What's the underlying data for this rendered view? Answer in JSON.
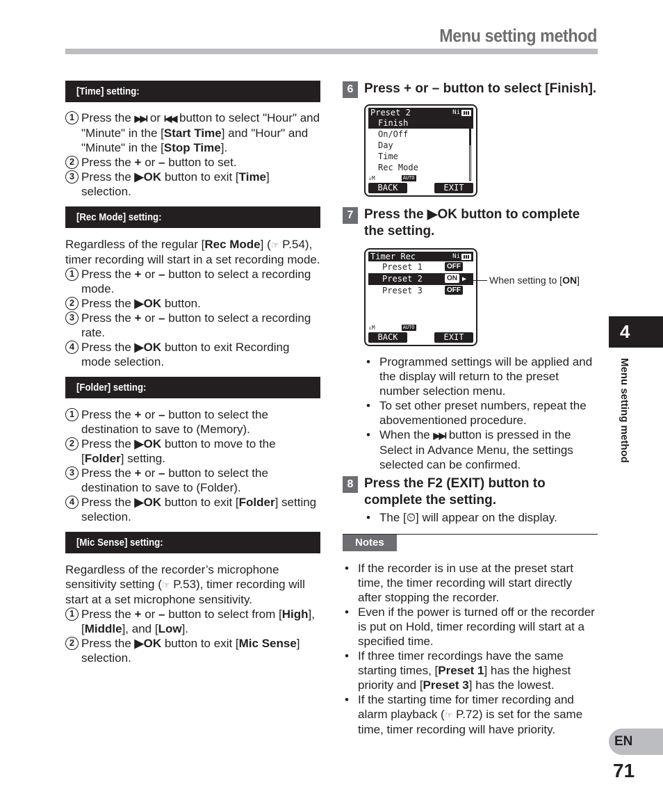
{
  "header": {
    "title": "Menu setting method"
  },
  "left": {
    "time": {
      "heading": "[Time] setting:",
      "steps": [
        {
          "n": "1",
          "a": "Press the ",
          "icon1": "▶▶I",
          "b": " or ",
          "icon2": "I◀◀",
          "c": " button to select \"Hour\" and \"Minute\" in the [",
          "bold1": "Start Time",
          "d": "] and \"Hour\" and \"Minute\" in the [",
          "bold2": "Stop Time",
          "e": "]."
        },
        {
          "n": "2",
          "a": "Press the ",
          "plus": "+",
          "b": " or ",
          "minus": "–",
          "c": " button to set."
        },
        {
          "n": "3",
          "a": "Press the ",
          "ok": "▶OK",
          "b": " button to exit [",
          "bold1": "Time",
          "c": "] selection."
        }
      ]
    },
    "recmode": {
      "heading": "[Rec Mode] setting:",
      "intro_a": "Regardless of the regular [",
      "intro_bold": "Rec Mode",
      "intro_b": "] (",
      "intro_ref": "☞",
      "intro_c": " P.54), timer recording will start in a set recording mode.",
      "steps": [
        {
          "n": "1",
          "a": "Press the ",
          "plus": "+",
          "b": " or ",
          "minus": "–",
          "c": " button to select a recording mode."
        },
        {
          "n": "2",
          "a": "Press the ",
          "ok": "▶OK",
          "b": " button."
        },
        {
          "n": "3",
          "a": "Press the ",
          "plus": "+",
          "b": " or ",
          "minus": "–",
          "c": " button to select a recording rate."
        },
        {
          "n": "4",
          "a": "Press the ",
          "ok": "▶OK",
          "b": " button to exit Recording mode selection."
        }
      ]
    },
    "folder": {
      "heading": "[Folder] setting:",
      "steps": [
        {
          "n": "1",
          "a": "Press the ",
          "plus": "+",
          "b": " or ",
          "minus": "–",
          "c": " button to select the destination to save to (Memory)."
        },
        {
          "n": "2",
          "a": "Press the ",
          "ok": "▶OK",
          "b": " button to move to the [",
          "bold1": "Folder",
          "c": "] setting."
        },
        {
          "n": "3",
          "a": "Press the ",
          "plus": "+",
          "b": " or ",
          "minus": "–",
          "c": " button to select the destination to save to (Folder)."
        },
        {
          "n": "4",
          "a": "Press the ",
          "ok": "▶OK",
          "b": " button to exit [",
          "bold1": "Folder",
          "c": "] setting selection."
        }
      ]
    },
    "micsense": {
      "heading": "[Mic Sense] setting:",
      "intro_a": "Regardless of the recorder’s microphone sensitivity setting (",
      "intro_ref": "☞",
      "intro_b": " P.53), timer recording will start at a set microphone sensitivity.",
      "steps": [
        {
          "n": "1",
          "a": "Press the ",
          "plus": "+",
          "b": " or ",
          "minus": "–",
          "c": " button to select from [",
          "bold1": "High",
          "d": "], [",
          "bold2": "Middle",
          "e": "], and [",
          "bold3": "Low",
          "f": "]."
        },
        {
          "n": "2",
          "a": "Press the ",
          "ok": "▶OK",
          "b": " button to exit [",
          "bold1": "Mic Sense",
          "c": "] selection."
        }
      ]
    }
  },
  "right": {
    "step6": {
      "num": "6",
      "text_a": "Press ",
      "text_b": "+",
      "text_c": " or ",
      "text_d": "–",
      "text_e": " button to select [Finish].",
      "lcd": {
        "title": "Preset 2",
        "battery_label": "Ni",
        "items": [
          "Finish",
          "On/Off",
          "Day",
          "Time",
          "Rec Mode"
        ],
        "selected_index": 0,
        "mic_icon": "🎙M",
        "auto_label": "AUTO",
        "back": "BACK",
        "exit": "EXIT"
      }
    },
    "step7": {
      "num": "7",
      "text_a": "Press the ",
      "ok": "▶OK",
      "text_b": " button to complete the setting.",
      "lcd": {
        "title": "Timer Rec",
        "battery_label": "Ni",
        "rows": [
          {
            "label": "Preset 1",
            "state": "OFF",
            "selected": false
          },
          {
            "label": "Preset 2",
            "state": "ON",
            "selected": true
          },
          {
            "label": "Preset 3",
            "state": "OFF",
            "selected": false
          }
        ],
        "arrow": "▶",
        "auto_label": "AUTO",
        "back": "BACK",
        "exit": "EXIT"
      },
      "callout_a": "When setting to [",
      "callout_bold": "ON",
      "callout_b": "]"
    },
    "bullets7": [
      {
        "text": "Programmed settings will be applied and the display will return to the preset number selection menu."
      },
      {
        "text": "To set other preset numbers, repeat the abovementioned procedure."
      },
      {
        "a": "When the ",
        "icon": "▶▶I",
        "b": " button is pressed in the Select in Advance Menu, the settings selected can be confirmed."
      }
    ],
    "step8": {
      "num": "8",
      "text": "Press the F2 (EXIT) button to complete the setting.",
      "bullet_a": "The [",
      "bullet_icon": "⏲",
      "bullet_b": "] will appear on the display."
    },
    "notes": {
      "label": "Notes",
      "items": [
        {
          "text": "If the recorder is in use at the preset start time, the timer recording will start directly after stopping the recorder."
        },
        {
          "text": "Even if the power is turned off or the recorder is put on Hold, timer recording will start at a specified time."
        },
        {
          "a": "If three timer recordings have the same starting times, [",
          "bold1": "Preset 1",
          "b": "] has the highest priority and [",
          "bold2": "Preset 3",
          "c": "] has the lowest."
        },
        {
          "a": "If the starting time for timer recording and alarm playback (",
          "ref": "☞",
          "b": " P.72) is set for the same time, timer recording will have priority."
        }
      ]
    }
  },
  "side": {
    "chapter": "4",
    "chapter_label": "Menu setting method",
    "lang": "EN",
    "page": "71"
  }
}
